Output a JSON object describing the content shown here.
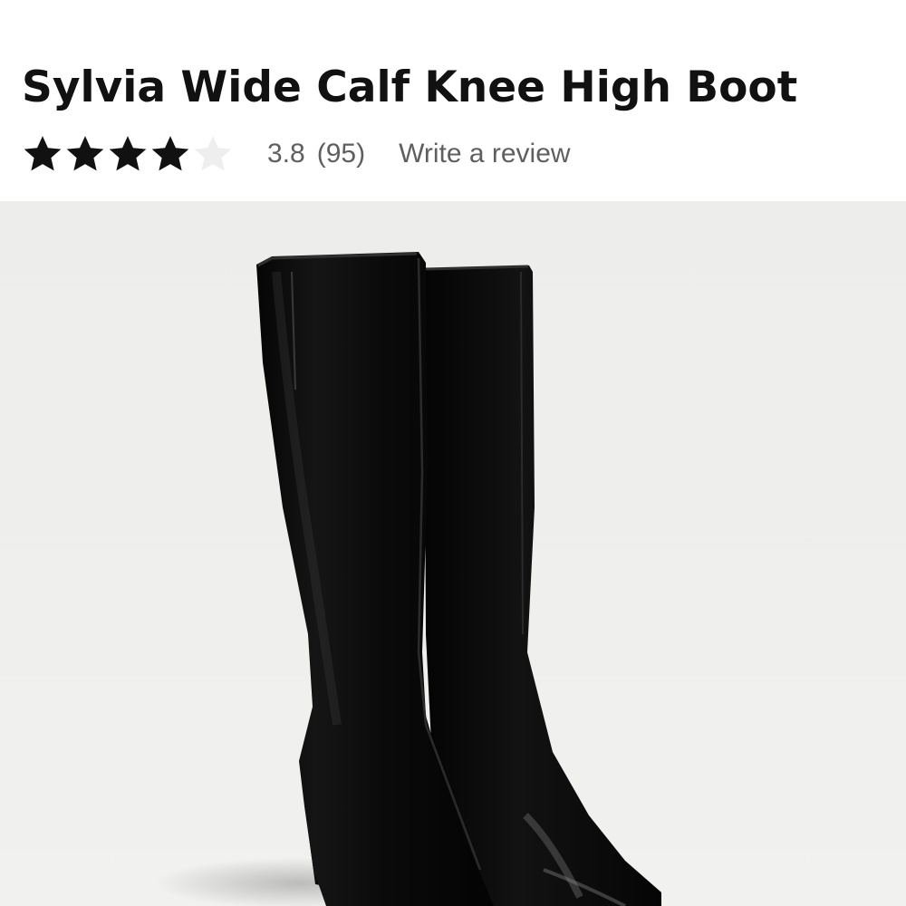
{
  "product": {
    "title": "Sylvia Wide Calf Knee High Boot",
    "rating": {
      "value": "3.8",
      "count": "(95)",
      "stars_filled": 4,
      "stars_total": 5,
      "star_color": "#111111",
      "empty_star_color": "#eeeeee"
    },
    "write_review_label": "Write a review"
  },
  "image": {
    "subject": "black knee-high boots product photo",
    "background_color": "#eeeeec"
  }
}
